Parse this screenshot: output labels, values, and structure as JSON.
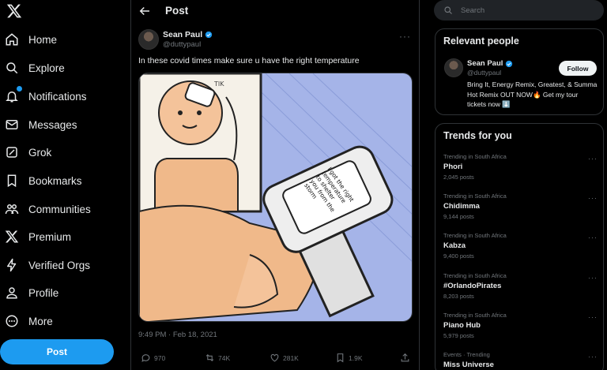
{
  "colors": {
    "accent": "#1d9bf0",
    "background": "#000000",
    "muted": "#71767b",
    "text": "#e7e9ea",
    "border": "#2f3336"
  },
  "nav": {
    "logo": "x-logo-icon",
    "items": [
      {
        "label": "Home",
        "icon": "home-icon"
      },
      {
        "label": "Explore",
        "icon": "search-icon"
      },
      {
        "label": "Notifications",
        "icon": "bell-icon"
      },
      {
        "label": "Messages",
        "icon": "mail-icon"
      },
      {
        "label": "Grok",
        "icon": "grok-icon"
      },
      {
        "label": "Bookmarks",
        "icon": "bookmark-icon"
      },
      {
        "label": "Communities",
        "icon": "communities-icon"
      },
      {
        "label": "Premium",
        "icon": "x-logo-icon"
      },
      {
        "label": "Verified Orgs",
        "icon": "lightning-icon"
      },
      {
        "label": "Profile",
        "icon": "person-icon"
      },
      {
        "label": "More",
        "icon": "more-circle-icon"
      }
    ],
    "post_button": "Post"
  },
  "header": {
    "title": "Post"
  },
  "tweet": {
    "author_name": "Sean Paul",
    "author_handle": "@duttypaul",
    "text": "In these covid times make sure u have the right temperature",
    "image_caption": "I got the right temperature to shelter you from the storm",
    "image_sfx": "TIK",
    "timestamp": "9:49 PM · Feb 18, 2021",
    "replies": "970",
    "reposts": "74K",
    "likes": "281K",
    "bookmarks": "1.9K"
  },
  "search": {
    "placeholder": "Search"
  },
  "relevant": {
    "title": "Relevant people",
    "name": "Sean Paul",
    "handle": "@duttypaul",
    "bio": "Bring It, Energy Remix, Greatest, & Summa Hot Remix OUT NOW🔥 Get my tour tickets now ⬇️",
    "follow_label": "Follow"
  },
  "trends": {
    "title": "Trends for you",
    "items": [
      {
        "context": "Trending in South Africa",
        "name": "Phori",
        "count": "2,045 posts"
      },
      {
        "context": "Trending in South Africa",
        "name": "Chidimma",
        "count": "9,144 posts"
      },
      {
        "context": "Trending in South Africa",
        "name": "Kabza",
        "count": "9,400 posts"
      },
      {
        "context": "Trending in South Africa",
        "name": "#OrlandoPirates",
        "count": "8,203 posts"
      },
      {
        "context": "Trending in South Africa",
        "name": "Piano Hub",
        "count": "5,979 posts"
      },
      {
        "context": "Events · Trending",
        "name": "Miss Universe",
        "count": ""
      }
    ]
  }
}
